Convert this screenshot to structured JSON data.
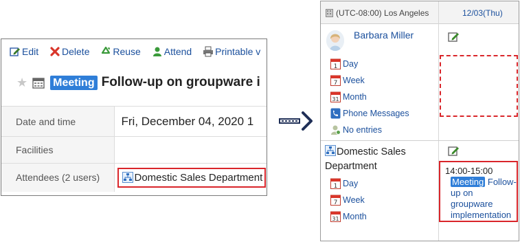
{
  "left": {
    "toolbar": [
      {
        "label": "Edit",
        "icon": "edit-icon"
      },
      {
        "label": "Delete",
        "icon": "delete-icon"
      },
      {
        "label": "Reuse",
        "icon": "reuse-icon"
      },
      {
        "label": "Attend",
        "icon": "attend-icon"
      },
      {
        "label": "Printable v",
        "icon": "print-icon"
      }
    ],
    "title": {
      "badge": "Meeting",
      "text": "Follow-up on groupware i"
    },
    "rows": [
      {
        "label": "Date and time",
        "value": "Fri, December 04, 2020   1"
      },
      {
        "label": "Facilities",
        "value": ""
      },
      {
        "label": "Attendees (2 users)",
        "value": "Domestic Sales Department"
      }
    ]
  },
  "right": {
    "timezone": "(UTC-08:00) Los Angeles",
    "date": "12/03(Thu)",
    "user": {
      "name": "Barbara Miller",
      "links": [
        "Day",
        "Week",
        "Month",
        "Phone Messages",
        "No entries"
      ]
    },
    "dept": {
      "name": "Domestic Sales Department",
      "links": [
        "Day",
        "Week",
        "Month"
      ]
    },
    "event": {
      "time": "14:00-15:00",
      "badge": "Meeting",
      "title": "Follow-up on groupware implementation"
    }
  },
  "colors": {
    "accent_red": "#d9252a",
    "link_blue": "#1a4f9c",
    "badge_blue": "#2f7ed8",
    "arrow_navy": "#1f2f57"
  }
}
